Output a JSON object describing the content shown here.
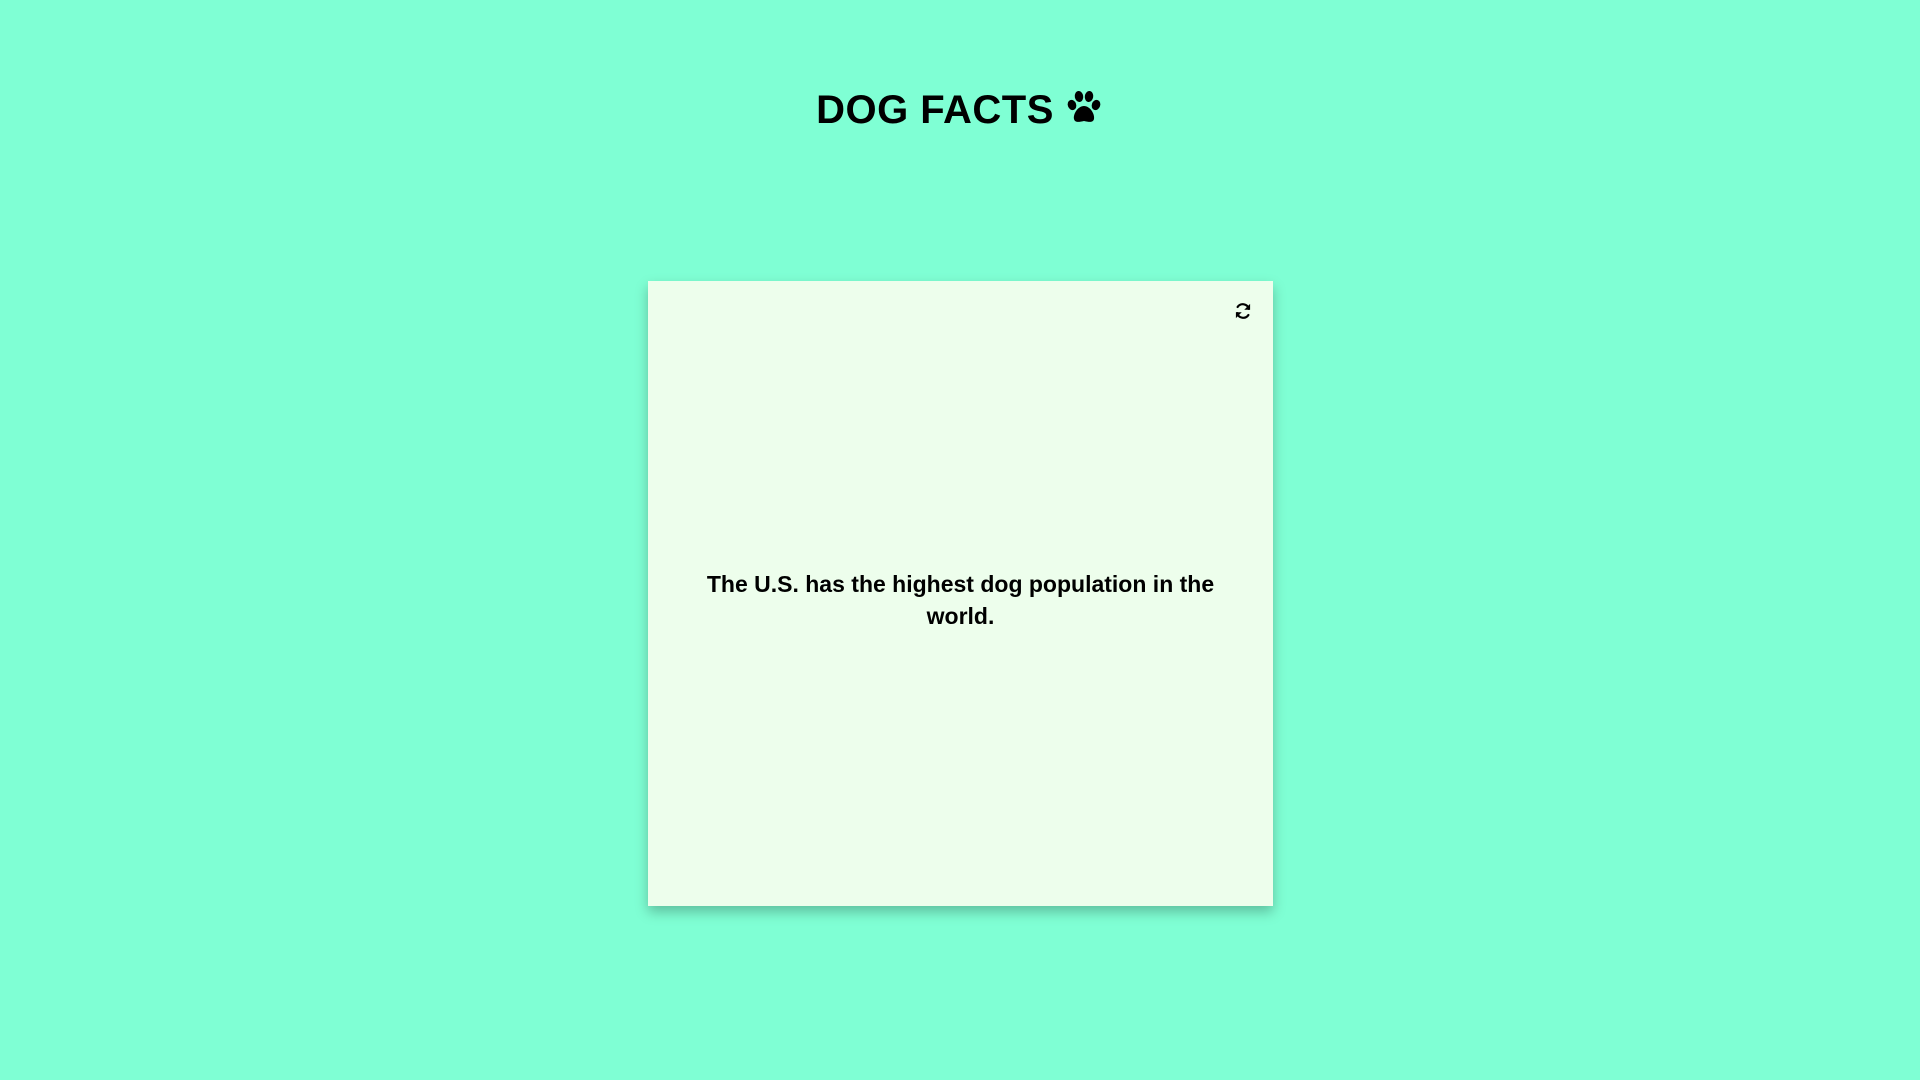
{
  "header": {
    "title": "DOG FACTS",
    "icon": "paw-icon"
  },
  "card": {
    "fact": "The U.S. has the highest dog population in the world.",
    "refresh_icon": "refresh-icon"
  },
  "colors": {
    "background": "#7fffd4",
    "card_background": "#edfeec",
    "text": "#000000"
  }
}
